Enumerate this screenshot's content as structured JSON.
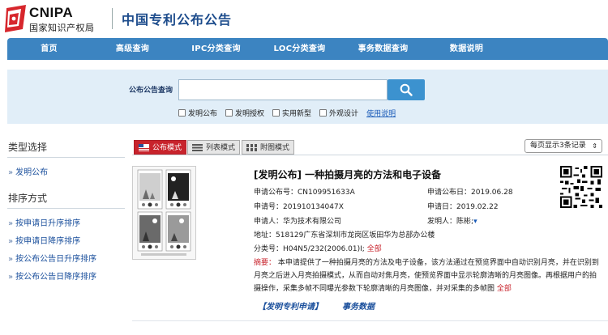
{
  "header": {
    "logo_text": "CNIPA",
    "logo_subtitle": "国家知识产权局",
    "site_title": "中国专利公布公告"
  },
  "nav": {
    "items": [
      {
        "label": "首页"
      },
      {
        "label": "高级查询"
      },
      {
        "label": "IPC分类查询"
      },
      {
        "label": "LOC分类查询"
      },
      {
        "label": "事务数据查询"
      },
      {
        "label": "数据说明"
      }
    ]
  },
  "search": {
    "label": "公布公告查询",
    "value": "",
    "placeholder": "",
    "filters": [
      {
        "label": "发明公布",
        "checked": false
      },
      {
        "label": "发明授权",
        "checked": false
      },
      {
        "label": "实用新型",
        "checked": false
      },
      {
        "label": "外观设计",
        "checked": false
      }
    ],
    "help_link": "使用说明"
  },
  "sidebar": {
    "type_heading": "类型选择",
    "type_items": [
      {
        "label": "发明公布"
      }
    ],
    "sort_heading": "排序方式",
    "sort_items": [
      {
        "label": "按申请日升序排序"
      },
      {
        "label": "按申请日降序排序"
      },
      {
        "label": "按公布公告日升序排序"
      },
      {
        "label": "按公布公告日降序排序"
      }
    ],
    "arrow": "»"
  },
  "modes": {
    "publish_mode": "公布模式",
    "list_mode": "列表模式",
    "figure_mode": "附图模式",
    "per_page": "每页显示3条记录",
    "per_page_caret": "⇕"
  },
  "record": {
    "title": "[发明公布] 一种拍摄月亮的方法和电子设备",
    "pub_no_label": "申请公布号：",
    "pub_no": "CN109951633A",
    "pub_date_label": "申请公布日：",
    "pub_date": "2019.06.28",
    "app_no_label": "申请号：",
    "app_no": "201910134047X",
    "app_date_label": "申请日：",
    "app_date": "2019.02.22",
    "applicant_label": "申请人：",
    "applicant": "华为技术有限公司",
    "inventor_label": "发明人：",
    "inventor": "陈彬;",
    "address_label": "地址：",
    "address": "518129广东省深圳市龙岗区坂田华为总部办公楼",
    "class_label": "分类号：",
    "class_no": "H04N5/232(2006.01)I;",
    "class_all": "全部",
    "abstract_label": "摘要：",
    "abstract_text": "本申请提供了一种拍摄月亮的方法及电子设备，该方法通过在预览界面中自动识别月亮，并在识别到月亮之后进入月亮拍摄模式，从而自动对焦月亮，使预览界面中显示轮廓清晰的月亮图像。再根据用户的拍摄操作，采集多帧不同曝光参数下轮廓清晰的月亮图像，并对采集的多帧图",
    "abstract_all": "全部",
    "link_patent_app": "【发明专利申请】",
    "link_transaction": "事务数据"
  }
}
